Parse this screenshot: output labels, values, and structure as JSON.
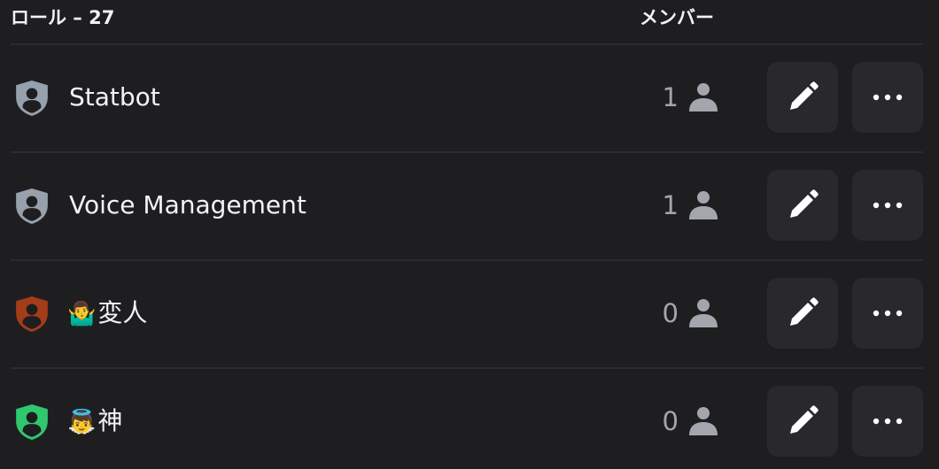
{
  "header": {
    "roles_label": "ロール – 27",
    "members_label": "メンバー"
  },
  "colors": {
    "background": "#1e1e21",
    "button_bg": "#29292d",
    "divider": "#2b2c30",
    "muted_text": "#a3a6ad"
  },
  "roles": [
    {
      "name": "Statbot",
      "emoji": "",
      "member_count": "1",
      "shield_color": "#97a1ad"
    },
    {
      "name": "Voice Management",
      "emoji": "",
      "member_count": "1",
      "shield_color": "#97a1ad"
    },
    {
      "name": "変人",
      "emoji": "🤷‍♂️",
      "member_count": "0",
      "shield_color": "#a33d17"
    },
    {
      "name": "神",
      "emoji": "👼",
      "member_count": "0",
      "shield_color": "#2fc86e"
    }
  ],
  "icons": {
    "role_icon": "shield-person-icon",
    "member_icon": "person-icon",
    "edit_icon": "pencil-icon",
    "more_icon": "more-dots-icon"
  }
}
